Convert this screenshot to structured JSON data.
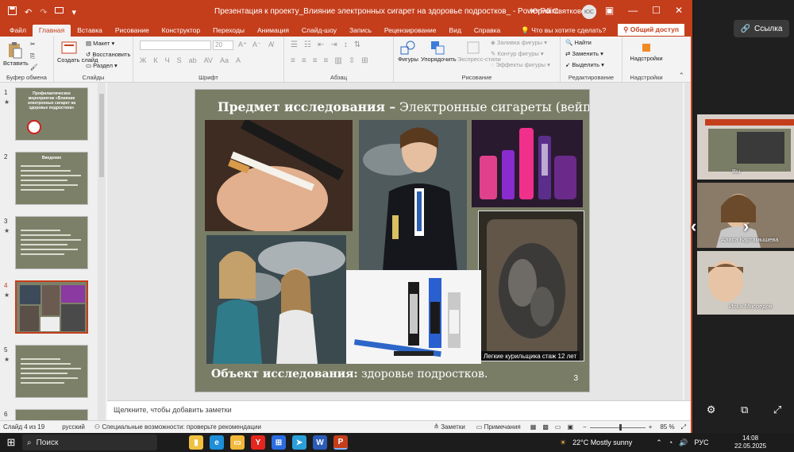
{
  "window": {
    "title": "Презентация к проекту_Влияние электронных сигарет на здоровье подростков_ - PowerPoint",
    "user": "Юрий Святковский",
    "user_initials": "ЮС",
    "quick_access": [
      "save-icon",
      "undo-icon",
      "redo-icon",
      "start-icon",
      "customize-icon"
    ]
  },
  "tabs": [
    "Файл",
    "Главная",
    "Вставка",
    "Рисование",
    "Конструктор",
    "Переходы",
    "Анимация",
    "Слайд-шоу",
    "Запись",
    "Рецензирование",
    "Вид",
    "Справка"
  ],
  "active_tab": "Главная",
  "tell_me": "Что вы хотите сделать?",
  "share_label": "Общий доступ",
  "ribbon": {
    "clipboard": {
      "name": "Буфер обмена",
      "paste": "Вставить"
    },
    "slides": {
      "name": "Слайды",
      "new_slide": "Создать слайд",
      "layout": "Макет",
      "reset": "Восстановить",
      "section": "Раздел"
    },
    "font": {
      "name": "Шрифт",
      "font_value": "",
      "size_value": "20",
      "buttons": [
        "Ж",
        "К",
        "Ч",
        "S",
        "ab",
        "AV",
        "Aa",
        "A"
      ]
    },
    "paragraph": {
      "name": "Абзац"
    },
    "drawing": {
      "name": "Рисование",
      "shapes": "Фигуры",
      "arrange": "Упорядочить",
      "quick_styles": "Экспресс-стили",
      "fill": "Заливка фигуры",
      "outline": "Контур фигуры",
      "effects": "Эффекты фигуры"
    },
    "editing": {
      "name": "Редактирование",
      "find": "Найти",
      "replace": "Заменить",
      "select": "Выделить"
    },
    "addins": {
      "name": "Надстройки",
      "label": "Надстройки"
    }
  },
  "thumbnails": [
    {
      "num": "1",
      "star": "★",
      "title": "Профилактическое мероприятие «Влияние электронных сигарет на здоровье подростков»"
    },
    {
      "num": "2",
      "star": "",
      "title": "Введение"
    },
    {
      "num": "3",
      "star": "★",
      "title": ""
    },
    {
      "num": "4",
      "star": "★",
      "title": ""
    },
    {
      "num": "5",
      "star": "★",
      "title": ""
    },
    {
      "num": "6",
      "star": "",
      "title": ""
    }
  ],
  "slide": {
    "heading_bold": "Предмет  исследования –",
    "heading_rest": " Электронные сигареты (вейпы)",
    "footer_bold": "Объект исследования:",
    "footer_rest": " здоровье подростков.",
    "page_number": "3",
    "lung_caption": "Легкие курильщика стаж 12 лет"
  },
  "notes_placeholder": "Щелкните, чтобы добавить заметки",
  "status": {
    "slide_counter": "Слайд 4 из 19",
    "language": "русский",
    "accessibility": "Специальные возможности: проверьте рекомендации",
    "notes": "Заметки",
    "comments": "Примечания",
    "zoom": "85 %",
    "zoom_level": 0.55
  },
  "side_panel": {
    "link_label": "Ссылка",
    "participants": [
      {
        "name": "Вы"
      },
      {
        "name": "Алиса Картамышева"
      },
      {
        "name": "Илья Мясоедов"
      }
    ]
  },
  "taskbar": {
    "search": "Поиск",
    "apps": [
      "explorer",
      "edge",
      "files",
      "yandex",
      "store",
      "telegram",
      "word",
      "powerpoint"
    ],
    "weather": "22°C  Mostly sunny",
    "lang": "РУС",
    "time": "14:08",
    "date": "22.05.2025"
  },
  "colors": {
    "accent": "#c43e1c",
    "slide_bg": "#7a7d66"
  }
}
